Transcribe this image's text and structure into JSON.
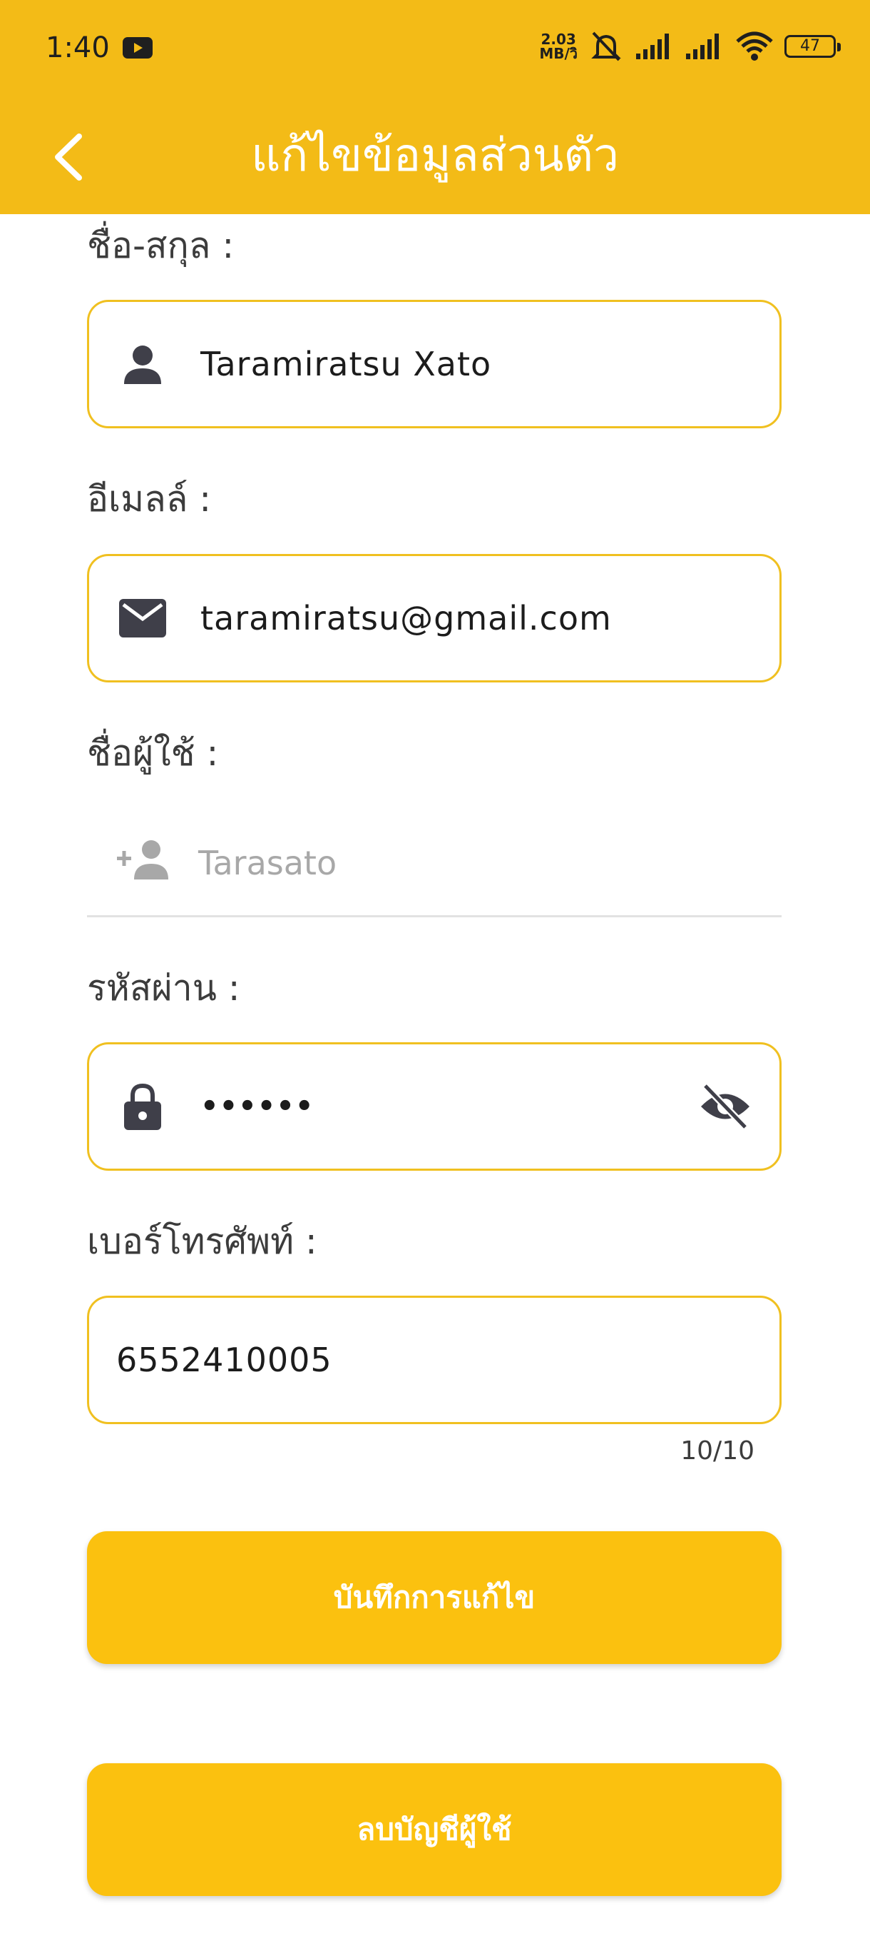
{
  "status_bar": {
    "time": "1:40",
    "net_speed_value": "2.03",
    "net_speed_unit": "MB/วิ",
    "battery": "47"
  },
  "app_bar": {
    "title": "แก้ไขข้อมูลส่วนตัว"
  },
  "form": {
    "name_label": "ชื่อ-สกุล :",
    "name_value": "Taramiratsu Xato",
    "email_label": "อีเมลล์ :",
    "email_value": "taramiratsu@gmail.com",
    "username_label": "ชื่อผู้ใช้ :",
    "username_value": "Tarasato",
    "password_label": "รหัสผ่าน :",
    "password_value": "••••••",
    "phone_label": "เบอร์โทรศัพท์ :",
    "phone_value": "6552410005",
    "phone_counter": "10/10"
  },
  "buttons": {
    "save_label": "บันทึกการแก้ไข",
    "delete_label": "ลบบัญชีผู้ใช้"
  },
  "colors": {
    "accent": "#f3bb17",
    "button": "#fbc10f",
    "field_border": "#f0c020"
  }
}
